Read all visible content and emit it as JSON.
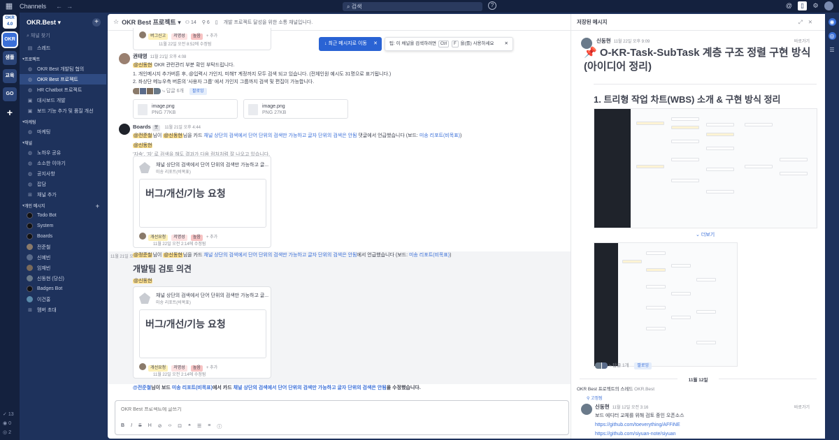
{
  "topbar": {
    "app_title": "Channels",
    "search_text": "검색"
  },
  "teams": [
    {
      "label": "OKR\n4.0"
    },
    {
      "label": "OKR"
    },
    {
      "label": "샘플"
    },
    {
      "label": "교육"
    },
    {
      "label": "GO"
    }
  ],
  "team_counts": {
    "a": "13",
    "b": "0",
    "c": "2"
  },
  "sidebar": {
    "team_name": "OKR.Best",
    "search_placeholder": "채널 찾기",
    "threads": "스레드",
    "cat_project": "프로젝트",
    "project_channels": [
      "OKR Best 개발팀 협의",
      "OKR Best 프로젝트",
      "HR Chatbot 프로젝트",
      "대시보드 개발",
      "보드 기능 추가 및 품질 개선"
    ],
    "cat_marketing": "마케팅",
    "marketing_channels": [
      "마케팅"
    ],
    "cat_channel": "채널",
    "channels": [
      "노하우 공유",
      "소소한 이야기",
      "공지사항",
      "잡담",
      "채널 추가"
    ],
    "cat_dm": "개인 메시지",
    "dms": [
      {
        "name": "Todo Bot",
        "color": "#1f232b"
      },
      {
        "name": "System",
        "color": "#1f232b"
      },
      {
        "name": "Boards",
        "color": "#1f232b"
      },
      {
        "name": "전준철",
        "color": "#8a7a6a"
      },
      {
        "name": "신예빈",
        "color": "#5a6b8a"
      },
      {
        "name": "임재빈",
        "color": "#7a6a5a"
      },
      {
        "name": "신동현 (당신)",
        "color": "#6a7a8a"
      },
      {
        "name": "Badges Bot",
        "color": "#1f232b"
      },
      {
        "name": "이건홍",
        "color": "#5a8aaa"
      }
    ],
    "invite": "멤버 초대"
  },
  "channel_header": {
    "name": "OKR Best 프로젝트",
    "members": "14",
    "pins": "6",
    "purpose": "개발 프로젝트 달성을 위한 소통 채널입니다."
  },
  "toast": {
    "jump": "최근 메시지로 이동",
    "tip_prefix": "팁: 이 채널을 검색하려면",
    "key1": "Ctrl",
    "key2": "F",
    "tip_suffix": "을(를) 사용하세요"
  },
  "top_card": {
    "tags": [
      "버그신고",
      "저명성",
      "높음"
    ],
    "add": "추가",
    "edited": "11월 22일 오전 8:52에 수정됨"
  },
  "msg1": {
    "user": "권태영",
    "time": "11월 21일 오후 4:08",
    "mention": "@신동현",
    "line0": " OKR 관련관리 부분 확인 부탁드립니다.",
    "line1": "1. 개인메시지 추가버튼 후, @입력시 가인지, 미해T 계정까지 모두 검색 되고 있습니다. (전체인원 예시도 31명으로 표기됩니다.)",
    "line2": "2. 좌상단 메뉴우측 버튼의 '사용자 그룹' 에서 가인지 그룹까지 검색 및 편집이 가능합니다.",
    "replies": "답글 6개",
    "follow": "팔로잉",
    "files": [
      {
        "name": "image.png",
        "meta": "PNG 77KB"
      },
      {
        "name": "image.png",
        "meta": "PNG 27KB"
      }
    ]
  },
  "msg2": {
    "user": "Boards",
    "badge": "봇",
    "time": "11월 21일 오후 4:44",
    "mention_a": "@전준철",
    "text_a": "님이",
    "mention_b": "@신동현",
    "text_b": "님을 카드 ",
    "card_link": "채널 상단의 검색에서 단어 단위의 검색만 가능하고 글자 단위의 검색은 안됨",
    "text_c": " 댓글에서 언급했습니다 (보드: ",
    "board_link": "미송 리포트(비목표)",
    "text_d": ")",
    "mention_c": "@신동현",
    "quote": "'자속', '자' 로 검색을 해도 결과가 다음 컴처처럼 잘 나오고 있습니다.",
    "card_title": "채널 상단의 검색에서 단어 단위의 검색만 가능하고 글...",
    "card_sub": "미송 리포트(비목표)",
    "big": "버그/개선/기능 요청",
    "tags": [
      "개선요청",
      "저명성",
      "높음"
    ],
    "add": "추가",
    "edited": "11월 22일 오전 2:14에 수정됨"
  },
  "msg3": {
    "time": "11월 21일 오",
    "mention_a": "@정준철",
    "text_a": "님이",
    "mention_b": "@신동현",
    "text_b": "님을 카드 ",
    "card_link": "채널 상단의 검색에서 단어 단위의 검색만 가능하고 글자 단위의 검색은 안됨",
    "text_c": "에서 언급했습니다 (보드: ",
    "board_link": "미송 리포트(비목표)",
    "text_d": ")",
    "heading": "개발팀 검토 의견",
    "mention_c": "@신동현",
    "card_title": "채널 상단의 검색에서 단어 단위의 검색만 가능하고 글...",
    "card_sub": "미송 리포트(비목표)",
    "big": "버그/개선/기능 요청",
    "tags": [
      "개선요청",
      "저명성",
      "높음"
    ],
    "add": "추가",
    "edited": "11월 22일 오전 2:14에 수정됨"
  },
  "msg4": {
    "mention_a": "@전준철",
    "text_a": "님이 보드 ",
    "board_link": "미송 리포트(비목표)",
    "text_b": "에서 카드 ",
    "card_link": "채널 상단의 검색에서 단어 단위의 검색만 가능하고 글자 단위의 검색은 안됨",
    "text_c": "을 수정했습니다."
  },
  "composer": {
    "placeholder": "OKR Best 프로젝트에 글쓰기"
  },
  "rhs": {
    "title": "저장된 메시지",
    "user": "신동현",
    "time": "11월 22일 오후 9:09",
    "jump": "바로가기",
    "heading": "📌 O-KR-Task-SubTask 계층 구조 정렬 구현 방식 (아이디어 정리)",
    "h2": "1. 트리형 작업 차트(WBS) 소개 & 구현 방식 정리",
    "more": "더보기",
    "replies": "답글 1개",
    "follow": "팔로잉",
    "date": "11월 12일",
    "thread_ch": "OKR Best 프로젝트의 스레드",
    "thread_team": "OKR.Best",
    "pinned": "고정됨",
    "user2": "신동현",
    "time2": "11월 12일 오전 3:16",
    "jump2": "바로가기",
    "line1": "보드 에디터 교체를 위해 검토 중인 오픈소스",
    "link1": "https://github.com/toeverything/AFFiNE",
    "link2": "https://github.com/siyuan-note/siyuan"
  },
  "colors": {
    "accent": "#2a63d4",
    "sidebar": "#1e325c",
    "mention": "#ffe08a"
  }
}
